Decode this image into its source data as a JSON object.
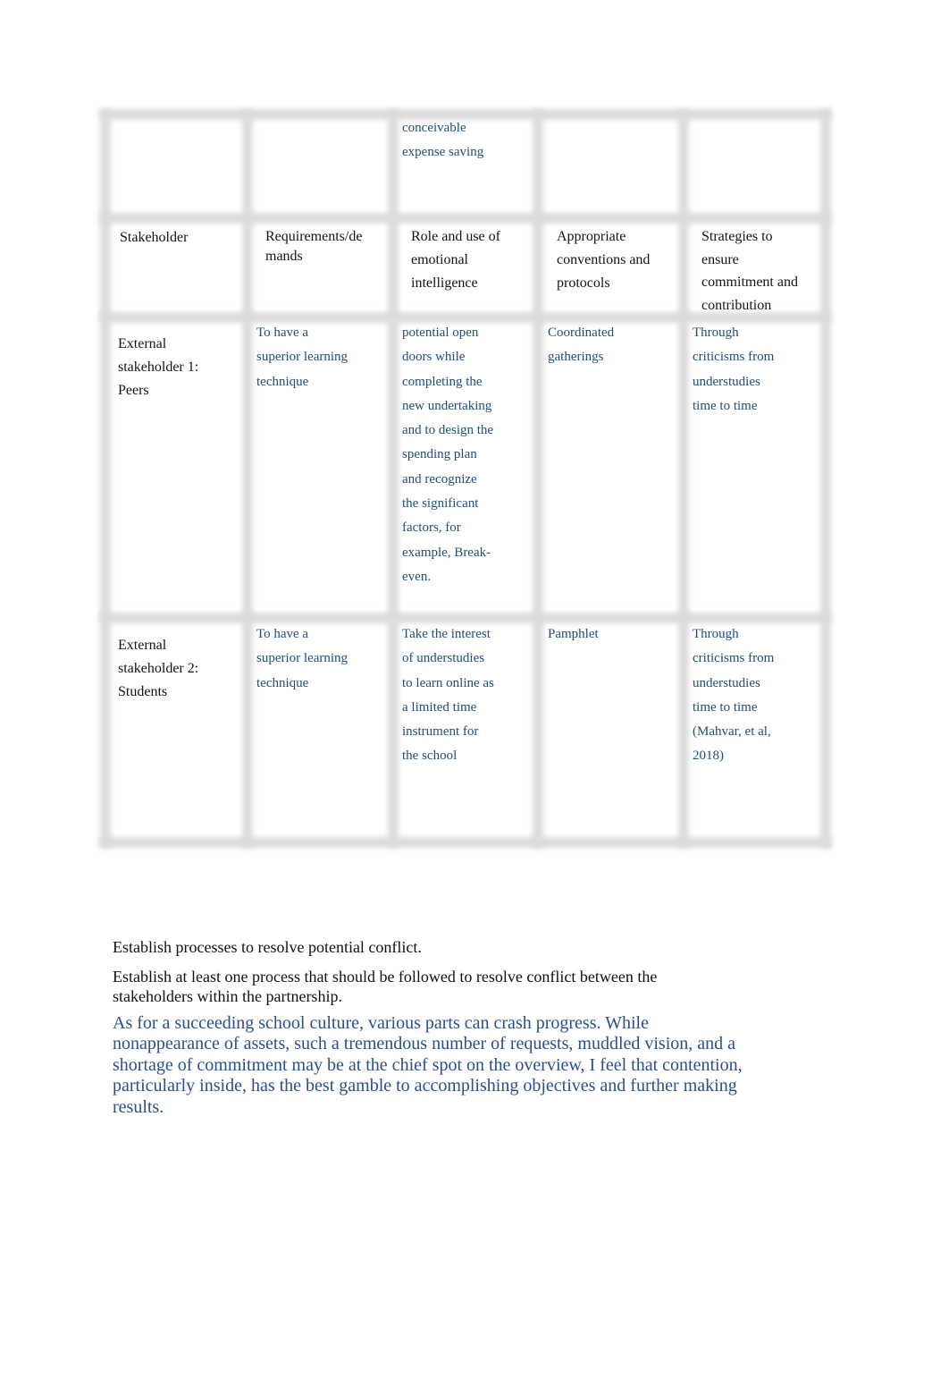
{
  "table": {
    "carryover_row": {
      "role": [
        "conceivable",
        "expense saving"
      ]
    },
    "headers": {
      "stakeholder": [
        "Stakeholder"
      ],
      "requirements": [
        "Requirements/de",
        "mands"
      ],
      "role": [
        "Role and use of",
        "emotional",
        "intelligence"
      ],
      "conventions": [
        "Appropriate",
        "conventions and",
        "protocols"
      ],
      "strategies": [
        "Strategies to",
        "ensure",
        "commitment and",
        "contribution"
      ]
    },
    "rows": [
      {
        "stakeholder": [
          "External",
          "stakeholder 1:",
          "Peers"
        ],
        "requirements": [
          "To have a",
          "superior learning",
          "technique"
        ],
        "role": [
          "potential open",
          "doors while",
          "completing the",
          "new undertaking",
          "and to design the",
          "spending plan",
          "and recognize",
          "the significant",
          "factors, for",
          "example, Break-",
          "even."
        ],
        "conventions": [
          "Coordinated",
          "gatherings"
        ],
        "strategies": [
          "Through",
          "criticisms from",
          "understudies",
          "time to time"
        ]
      },
      {
        "stakeholder": [
          "External",
          "stakeholder 2:",
          "Students"
        ],
        "requirements": [
          "To have a",
          "superior learning",
          "technique"
        ],
        "role": [
          "Take the interest",
          "of understudies",
          "to learn online as",
          "a limited time",
          "instrument for",
          "the school"
        ],
        "conventions": [
          "Pamphlet"
        ],
        "strategies": [
          "Through",
          "criticisms from",
          "understudies",
          "time to time",
          "(Mahvar, et al,",
          "2018)"
        ]
      }
    ]
  },
  "section": {
    "heading": "Establish processes to resolve potential conflict.",
    "instruction_lines": [
      "Establish at least one process that should be followed to resolve conflict between the",
      "stakeholders within the partnership."
    ],
    "answer_lines": [
      "As for a succeeding school culture, various parts can crash progress. While",
      "nonappearance of assets, such a tremendous number of requests, muddled vision, and a",
      "shortage of commitment may be at the chief spot on the overview, I feel that contention,",
      "particularly inside, has the best gamble to accomplishing objectives and further making",
      "results."
    ]
  },
  "colors": {
    "answer_text": "#1f4e79",
    "paragraph_blue": "#2a4f8f",
    "gridline": "#dcdcdc"
  }
}
